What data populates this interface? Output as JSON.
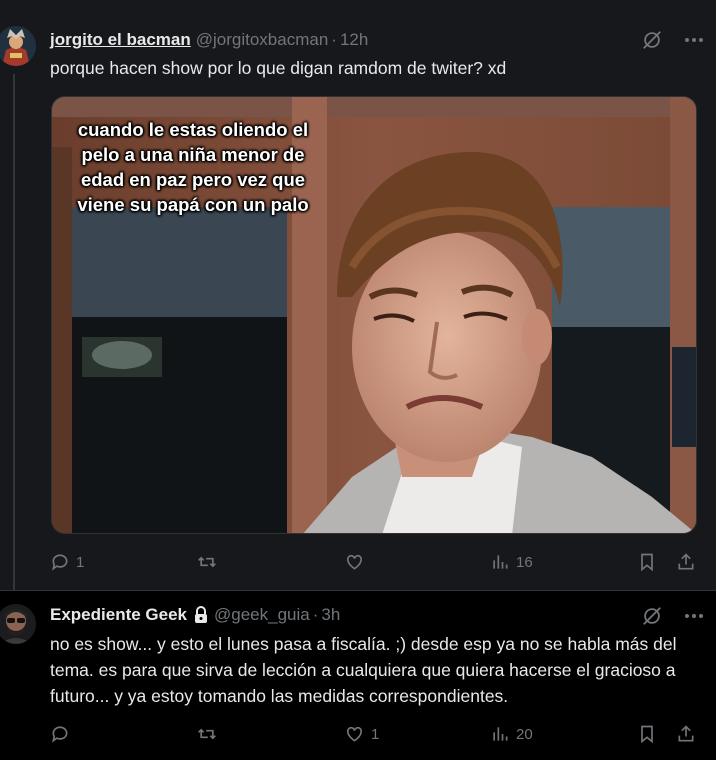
{
  "tweets": [
    {
      "display_name": "jorgito el bacman",
      "handle": "@jorgitoxbacman",
      "separator": "·",
      "time": "12h",
      "text": "porque hacen show por lo que digan ramdom de twiter? xd",
      "media_caption": "cuando le estas oliendo el pelo a una niña menor de edad en paz pero vez que viene su papá con un palo",
      "stats": {
        "replies": "1",
        "retweets": "",
        "likes": "",
        "views": "16"
      }
    },
    {
      "display_name": "Expediente Geek",
      "handle": "@geek_guia",
      "separator": "·",
      "time": "3h",
      "text": "no es show... y esto el lunes pasa a fiscalía. ;) desde esp ya no se habla más del tema. es para que sirva de lección a cualquiera que quiera hacerse el gracioso a futuro... y ya estoy tomando las medidas correspondientes.",
      "stats": {
        "replies": "",
        "retweets": "",
        "likes": "1",
        "views": "20"
      }
    }
  ],
  "colors": {
    "background": "#000000",
    "highlight_background": "#16181c",
    "primary_text": "#e7e9ea",
    "secondary_text": "#71767b"
  },
  "icons": [
    "grok-icon",
    "more-icon",
    "lock-icon",
    "reply-icon",
    "retweet-icon",
    "like-icon",
    "views-icon",
    "bookmark-icon",
    "share-icon"
  ]
}
